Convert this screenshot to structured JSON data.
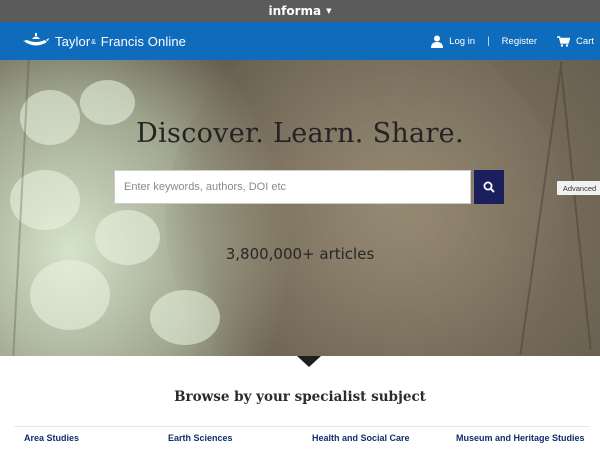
{
  "topbar": {
    "brand": "informa"
  },
  "header": {
    "logo_text_1": "Taylor",
    "logo_amp": "&",
    "logo_text_2": "Francis Online",
    "login_label": "Log in",
    "divider": "|",
    "register_label": "Register",
    "cart_label": "Cart"
  },
  "hero": {
    "title": "Discover. Learn. Share.",
    "search_placeholder": "Enter keywords, authors, DOI etc",
    "advanced_label": "Advanced",
    "article_count": "3,800,000+ articles"
  },
  "browse": {
    "title": "Browse by your specialist subject",
    "subjects": [
      "Area Studies",
      "Earth Sciences",
      "Health and Social Care",
      "Museum and Heritage Studies"
    ]
  },
  "colors": {
    "header_blue": "#0f6cbd",
    "informa_gray": "#5b5b5b",
    "search_button": "#1b1f5c",
    "subject_link": "#0f2f6b"
  }
}
